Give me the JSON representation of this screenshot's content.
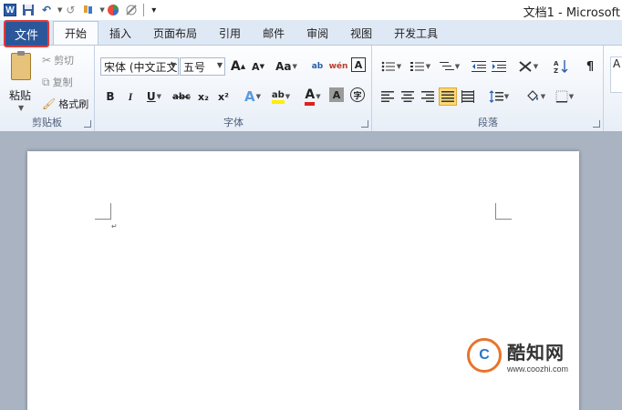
{
  "window": {
    "title": "文档1 - Microsoft"
  },
  "qat": {
    "logo": "W",
    "undo_glyph": "↶",
    "redo_glyph": "↺",
    "separator_glyph": "|",
    "more_glyph": "▾"
  },
  "tabs": [
    {
      "label": "文件"
    },
    {
      "label": "开始"
    },
    {
      "label": "插入"
    },
    {
      "label": "页面布局"
    },
    {
      "label": "引用"
    },
    {
      "label": "邮件"
    },
    {
      "label": "审阅"
    },
    {
      "label": "视图"
    },
    {
      "label": "开发工具"
    }
  ],
  "clipboard": {
    "group_label": "剪贴板",
    "paste_label": "粘贴",
    "cut_label": "剪切",
    "copy_label": "复制",
    "format_painter_label": "格式刷"
  },
  "font": {
    "group_label": "字体",
    "font_name": "宋体 (中文正文",
    "font_size": "五号",
    "grow_glyph": "A",
    "shrink_glyph": "A",
    "case_glyph": "Aa",
    "phonetic_glyph": "ab",
    "wen_glyph": "wén",
    "border_glyph": "A",
    "bold": "B",
    "italic": "I",
    "underline": "U",
    "strike": "abc",
    "subscript": "x₂",
    "superscript": "x²",
    "effects_glyph": "A",
    "highlight_glyph": "ab",
    "color_glyph": "A",
    "shading_glyph": "A",
    "circle_glyph": "字"
  },
  "paragraph": {
    "group_label": "段落"
  },
  "styles": {
    "preview_glyph": "A"
  },
  "watermark": {
    "brand": "酷知网",
    "url": "www.coozhi.com",
    "logo_text": "C"
  },
  "colors": {
    "file_tab": "#2b579a",
    "file_tab_outline": "#e03a3a",
    "ribbon_bg": "#e8eef7",
    "workspace": "#a9b3c1",
    "page": "#ffffff"
  }
}
